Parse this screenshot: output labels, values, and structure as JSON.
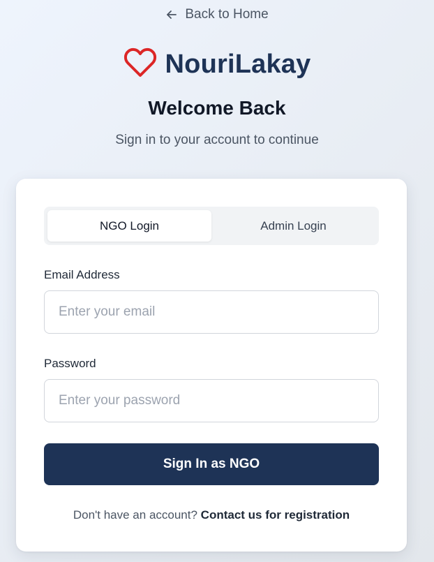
{
  "nav": {
    "back_label": "Back to Home",
    "back_icon": "arrow-left-icon"
  },
  "brand": {
    "name": "NouriLakay",
    "icon": "heart-icon",
    "icon_color": "#dc2626",
    "text_color": "#1e3356"
  },
  "header": {
    "title": "Welcome Back",
    "subtitle": "Sign in to your account to continue"
  },
  "login": {
    "tabs": [
      {
        "label": "NGO Login",
        "active": true
      },
      {
        "label": "Admin Login",
        "active": false
      }
    ],
    "email": {
      "label": "Email Address",
      "value": "",
      "placeholder": "Enter your email"
    },
    "password": {
      "label": "Password",
      "value": "",
      "placeholder": "Enter your password"
    },
    "submit_label": "Sign In as NGO",
    "submit_color": "#1e3356",
    "footer_text": "Don't have an account?",
    "footer_link": "Contact us for registration"
  }
}
